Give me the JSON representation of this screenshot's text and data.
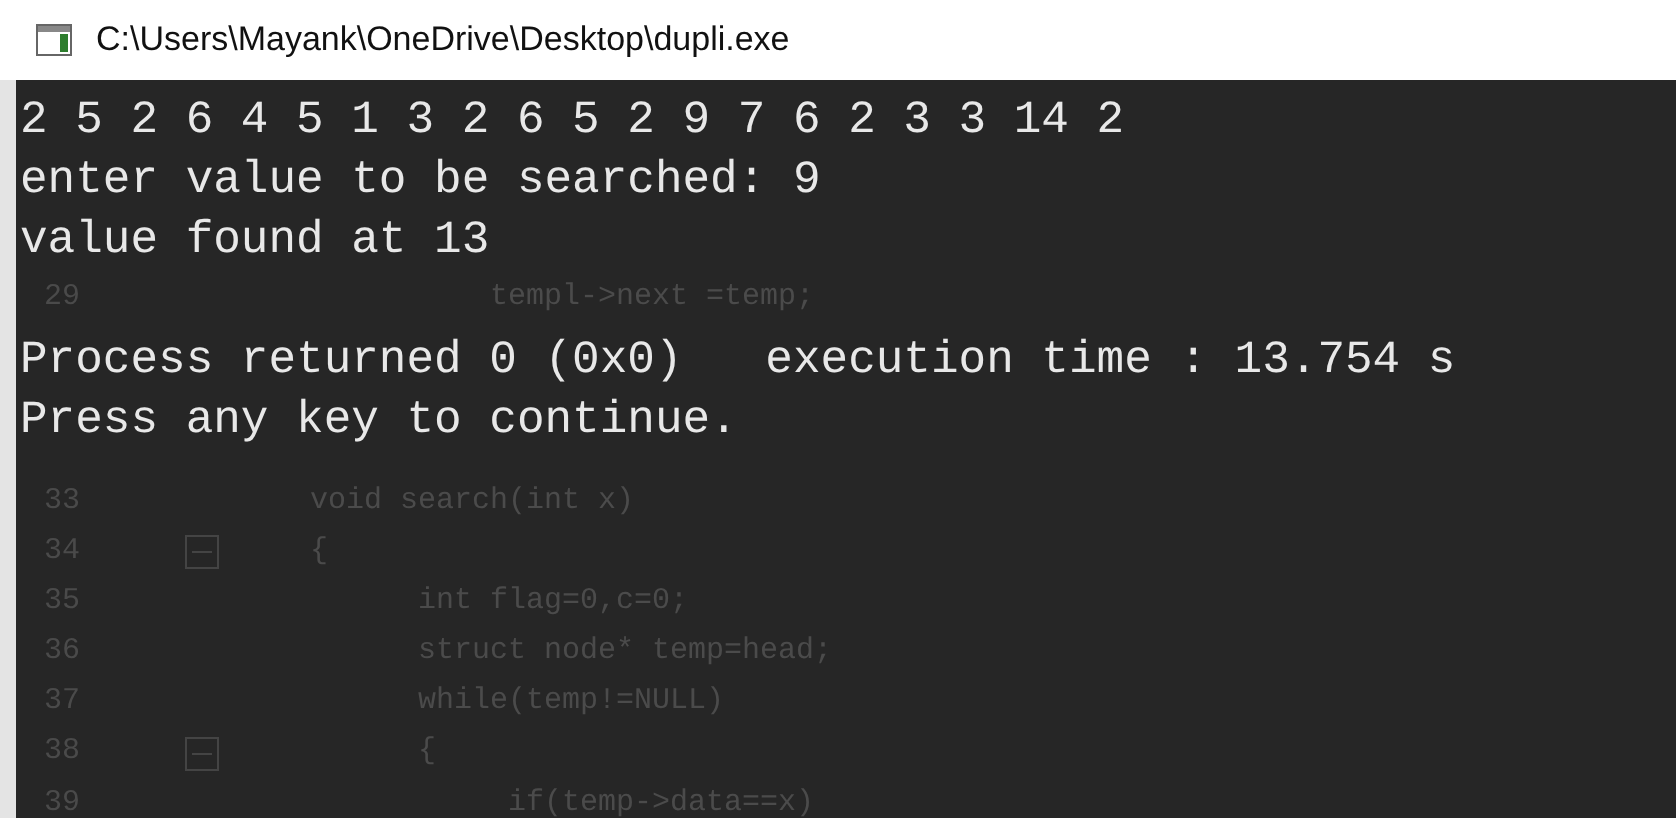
{
  "window": {
    "title": "C:\\Users\\Mayank\\OneDrive\\Desktop\\dupli.exe"
  },
  "console": {
    "output_lines": [
      "2 5 2 6 4 5 1 3 2 6 5 2 9 7 6 2 3 3 14 2",
      "enter value to be searched: 9",
      "value found at 13"
    ],
    "status_lines": [
      "Process returned 0 (0x0)   execution time : 13.754 s",
      "Press any key to continue."
    ]
  },
  "background_editor": {
    "upper_lines": [
      {
        "number": "29",
        "code": "          templ->next =temp;",
        "fold": false
      }
    ],
    "lower_lines": [
      {
        "number": "33",
        "code": "void search(int x)",
        "fold": false
      },
      {
        "number": "34",
        "code": "{",
        "fold": true
      },
      {
        "number": "35",
        "code": "      int flag=0,c=0;",
        "fold": false
      },
      {
        "number": "36",
        "code": "      struct node* temp=head;",
        "fold": false
      },
      {
        "number": "37",
        "code": "      while(temp!=NULL)",
        "fold": false
      },
      {
        "number": "38",
        "code": "      {",
        "fold": true
      },
      {
        "number": "39",
        "code": "           if(temp->data==x)",
        "fold": false
      }
    ]
  }
}
